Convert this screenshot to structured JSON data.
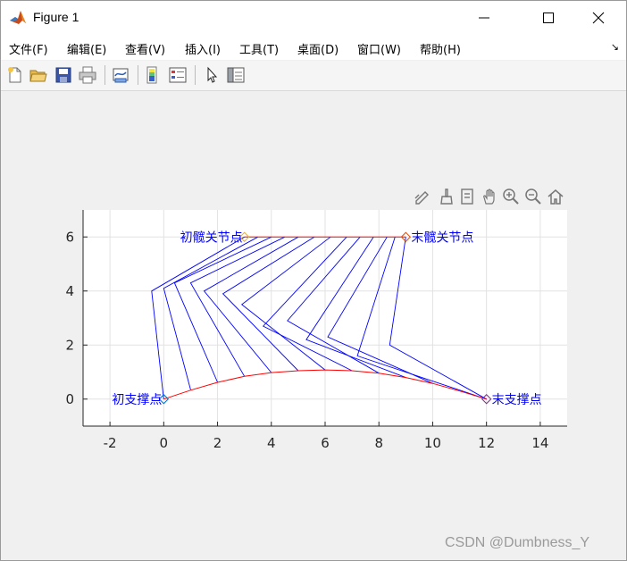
{
  "window": {
    "title": "Figure 1"
  },
  "menu": {
    "items": [
      {
        "label": "文件(F)"
      },
      {
        "label": "编辑(E)"
      },
      {
        "label": "查看(V)"
      },
      {
        "label": "插入(I)"
      },
      {
        "label": "工具(T)"
      },
      {
        "label": "桌面(D)"
      },
      {
        "label": "窗口(W)"
      },
      {
        "label": "帮助(H)"
      }
    ]
  },
  "toolbar": {
    "icons": [
      "new-figure-icon",
      "open-file-icon",
      "save-icon",
      "print-icon",
      "link-plot-icon",
      "insert-colorbar-icon",
      "insert-legend-icon",
      "edit-plot-icon",
      "property-inspector-icon"
    ]
  },
  "axes_toolbar": {
    "icons": [
      "data-tips-icon",
      "brush-icon",
      "export-icon",
      "pan-icon",
      "zoom-in-icon",
      "zoom-out-icon",
      "home-icon"
    ]
  },
  "watermark": "CSDN @Dumbness_Y",
  "chart_data": {
    "type": "line",
    "xlim": [
      -3,
      15
    ],
    "ylim": [
      -1,
      7
    ],
    "xticks": [
      -2,
      0,
      2,
      4,
      6,
      8,
      10,
      12,
      14
    ],
    "yticks": [
      0,
      2,
      4,
      6
    ],
    "grid": true,
    "hip_line": {
      "color": "#ff0000",
      "points": [
        [
          3,
          6
        ],
        [
          9,
          6
        ]
      ]
    },
    "support_curve": {
      "color": "#ff0000",
      "points": [
        [
          0,
          0
        ],
        [
          1,
          0.33
        ],
        [
          2,
          0.62
        ],
        [
          3,
          0.84
        ],
        [
          4,
          0.98
        ],
        [
          5,
          1.05
        ],
        [
          6,
          1.08
        ],
        [
          7,
          1.05
        ],
        [
          8,
          0.96
        ],
        [
          9,
          0.8
        ],
        [
          10,
          0.58
        ],
        [
          11,
          0.3
        ],
        [
          12,
          0
        ]
      ]
    },
    "legs": {
      "color": "#0000ff",
      "polylines": [
        [
          [
            0,
            0
          ],
          [
            -0.45,
            4
          ],
          [
            3,
            6
          ]
        ],
        [
          [
            1,
            0.35
          ],
          [
            0,
            4.1
          ],
          [
            3.5,
            6
          ]
        ],
        [
          [
            2,
            0.62
          ],
          [
            0.4,
            4.3
          ],
          [
            4,
            6
          ]
        ],
        [
          [
            3,
            0.84
          ],
          [
            1,
            4.3
          ],
          [
            4.5,
            6
          ]
        ],
        [
          [
            4,
            0.98
          ],
          [
            1.5,
            4
          ],
          [
            5,
            6
          ]
        ],
        [
          [
            5,
            1.05
          ],
          [
            2.2,
            3.9
          ],
          [
            5.6,
            6
          ]
        ],
        [
          [
            6,
            1.08
          ],
          [
            2.9,
            3.5
          ],
          [
            6.2,
            6
          ]
        ],
        [
          [
            7,
            1.05
          ],
          [
            3.7,
            2.7
          ],
          [
            6.8,
            6
          ]
        ],
        [
          [
            8,
            0.96
          ],
          [
            4.6,
            2.9
          ],
          [
            7.3,
            6
          ]
        ],
        [
          [
            9,
            0.8
          ],
          [
            5.3,
            2.2
          ],
          [
            7.8,
            6
          ]
        ],
        [
          [
            10,
            0.58
          ],
          [
            6.1,
            2.3
          ],
          [
            8.3,
            6
          ]
        ],
        [
          [
            12,
            0
          ],
          [
            7.2,
            1.6
          ],
          [
            8.6,
            6
          ]
        ],
        [
          [
            12,
            0
          ],
          [
            8.4,
            2
          ],
          [
            9,
            6
          ]
        ]
      ]
    },
    "markers": [
      {
        "x": 0,
        "y": 0,
        "color": "#0072bd",
        "shape": "diamond"
      },
      {
        "x": 12,
        "y": 0,
        "color": "#7e2f8e",
        "shape": "diamond"
      },
      {
        "x": 3,
        "y": 6,
        "color": "#edb120",
        "shape": "diamond"
      },
      {
        "x": 9,
        "y": 6,
        "color": "#d95319",
        "shape": "diamond"
      }
    ],
    "annotations": [
      {
        "text": "初支撑点",
        "x": 0,
        "y": 0,
        "align": "end",
        "color": "#0000ff"
      },
      {
        "text": "末支撑点",
        "x": 12,
        "y": 0,
        "align": "start",
        "color": "#0000ff"
      },
      {
        "text": "初髋关节点",
        "x": 3,
        "y": 6,
        "align": "end",
        "color": "#0000ff"
      },
      {
        "text": "末髋关节点",
        "x": 9,
        "y": 6,
        "align": "start",
        "color": "#0000ff"
      }
    ]
  }
}
